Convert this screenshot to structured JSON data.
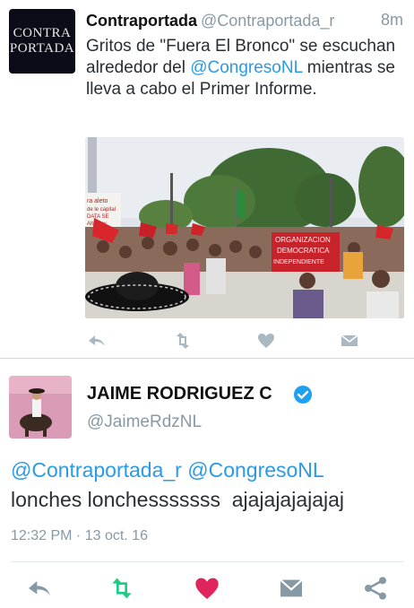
{
  "tweet1": {
    "avatar": {
      "line1": "CONTRA",
      "line2": "PORTADA"
    },
    "display_name": "Contraportada",
    "handle": "@Contraportada_r",
    "time": "8m",
    "text_part1": "Gritos de \"Fuera El Bronco\" se escuchan alrededor del ",
    "mention": "@CongresoNL",
    "text_part2": " mientras se lleva a cabo el Primer Informe.",
    "photo_signs": {
      "left_sign": "ra aleto\nde le capital\nDATA SE\nAlto hay\nMuch",
      "banner": "ORGANIZACION\nDEMOCRATICA\nINDEPENDIENTE"
    },
    "actions": {
      "reply_icon": "reply-icon",
      "retweet_icon": "retweet-icon",
      "like_icon": "heart-icon",
      "dm_icon": "envelope-icon"
    }
  },
  "tweet2": {
    "display_name": "JAIME RODRIGUEZ C",
    "verified": true,
    "handle": "@JaimeRdzNL",
    "mention1": "@Contraportada_r",
    "mention2": "@CongresoNL",
    "text": "lonches lonchesssssss  ajajajajajajaj",
    "timestamp": "12:32 PM · 13 oct. 16",
    "actions": {
      "reply_icon": "reply-icon",
      "retweet_icon": "retweet-icon",
      "like_icon": "heart-icon",
      "dm_icon": "envelope-icon",
      "share_icon": "share-icon"
    }
  },
  "colors": {
    "link": "#2b9ae8",
    "muted": "#8899a6",
    "retweet_active": "#19cf86",
    "like_active": "#e0245e",
    "verified": "#1da1f2"
  }
}
